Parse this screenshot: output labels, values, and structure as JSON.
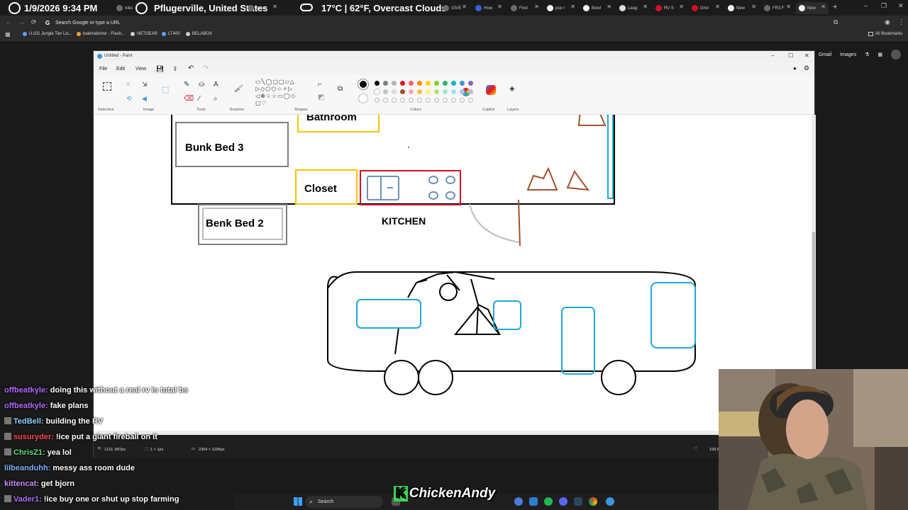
{
  "browser": {
    "tabs": [
      {
        "label": "si"
      },
      {
        "label": "niko"
      },
      {
        "label": "sarah"
      },
      {
        "label": "GIVE"
      },
      {
        "label": "How"
      },
      {
        "label": "Find"
      },
      {
        "label": "pse r"
      },
      {
        "label": "Bowl"
      },
      {
        "label": "Leag"
      },
      {
        "label": "RV S"
      },
      {
        "label": "Drivi"
      },
      {
        "label": "New"
      },
      {
        "label": "FR3 F"
      },
      {
        "label": "New"
      }
    ],
    "overlay": {
      "datetime": "1/9/2026 9:34 PM",
      "location": "Pflugerville, United States",
      "weather": "17°C | 62°F, Overcast Clouds"
    },
    "address_placeholder": "Search Google or type a URL",
    "bookmarks": [
      "U.GG Jungle Tier Lis...",
      "baleinaitcher - Flash...",
      "NETGEAR",
      "LT400",
      "BELABOX"
    ],
    "all_bookmarks": "All Bookmarks",
    "google_links": [
      "Gmail",
      "Images"
    ]
  },
  "paint": {
    "title": "Untitled - Paint",
    "menu": [
      "File",
      "Edit",
      "View"
    ],
    "ribbon_groups": [
      "Selection",
      "Image",
      "Tools",
      "Brushes",
      "Shapes",
      "Colors",
      "Copilot",
      "Layers"
    ],
    "colors": [
      "#000000",
      "#7f7f7f",
      "#b5b5b5",
      "#e81123",
      "#ff5c5c",
      "#ff8c00",
      "#ffd400",
      "#7ed321",
      "#2bb673",
      "#00b7c3",
      "#3a96dd",
      "#8764b8",
      "#ffffff",
      "#c3c3c3",
      "#dcdcdc",
      "#a0522d",
      "#f7a6b8",
      "#f2c14e",
      "#fff176",
      "#b7e07a",
      "#a8e6cf",
      "#9fe3ee",
      "#a8c7f0",
      "#c8b4e6"
    ],
    "drawing": {
      "labels": {
        "bathroom": "Bathroom",
        "bunk_bed_3": "Bunk Bed 3",
        "closet": "Closet",
        "benk_bed_2": "Benk Bed 2",
        "kitchen": "KITCHEN"
      }
    },
    "status": {
      "cursor": "1122, 887px",
      "selection": "1 × 1px",
      "canvas_size": "2304 × 1296px",
      "zoom": "158.5"
    }
  },
  "chat": [
    {
      "user": "offbeatkyle:",
      "color": "#b06cff",
      "msg": "doing this without a real rv is total bs",
      "badge": false
    },
    {
      "user": "offbeatkyle:",
      "color": "#b06cff",
      "msg": "fake plans",
      "badge": false
    },
    {
      "user": "TedBell:",
      "color": "#8fd0ff",
      "msg": "building the RV",
      "badge": true
    },
    {
      "user": "susuryder:",
      "color": "#ff4b4b",
      "msg": "!ice put a giant fireball on it",
      "badge": true
    },
    {
      "user": "ChrisZ1:",
      "color": "#5be37c",
      "msg": "yea lol",
      "badge": true
    },
    {
      "user": "lilbeanduhh:",
      "color": "#7fb2ff",
      "msg": "messy ass room dude",
      "badge": false
    },
    {
      "user": "kittencat:",
      "color": "#c88cff",
      "msg": "get bjorn",
      "badge": false
    },
    {
      "user": "Vader1:",
      "color": "#b06cff",
      "msg": "!ice buy one or shut up stop farming",
      "badge": true
    }
  ],
  "taskbar": {
    "search_label": "Search",
    "streamer": "ChickenAndy",
    "streamer_mark": "K"
  },
  "accent": {
    "drawing_blue": "#22a7d6",
    "drawing_brown": "#a0522d",
    "drawing_yellow": "#f5c400",
    "drawing_red": "#d0102a",
    "drawing_slate": "#6f8fb5"
  }
}
